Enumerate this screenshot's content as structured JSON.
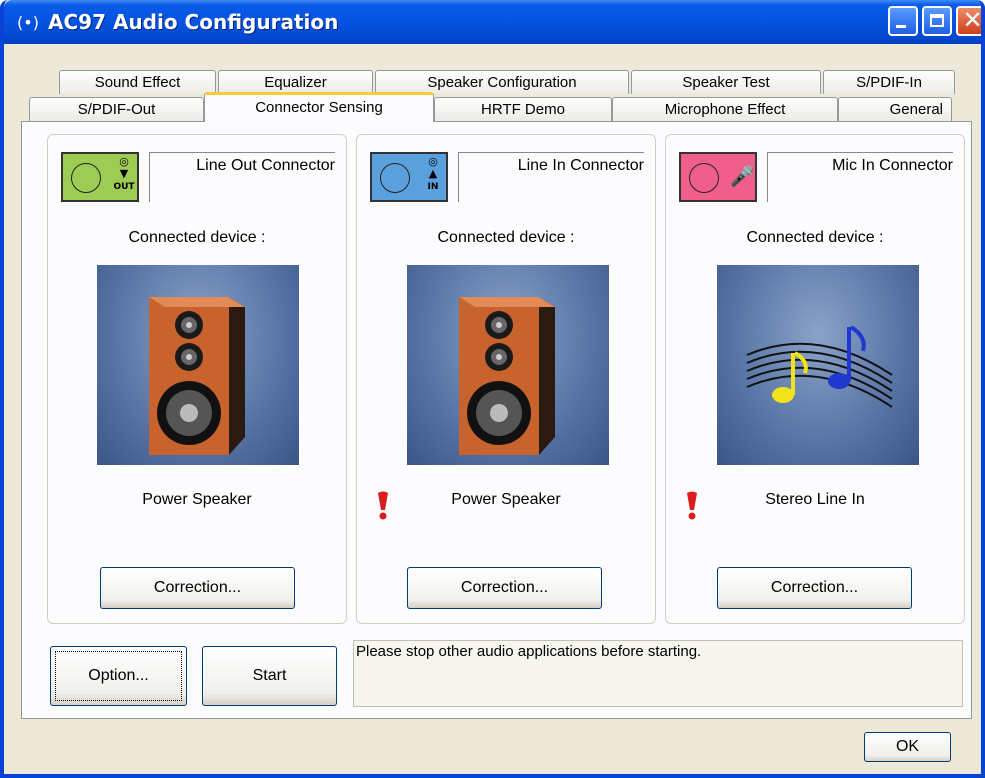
{
  "window": {
    "title": "AC97 Audio Configuration"
  },
  "tabs": {
    "row1": [
      "Sound Effect",
      "Equalizer",
      "Speaker Configuration",
      "Speaker Test",
      "S/PDIF-In"
    ],
    "row2": [
      "S/PDIF-Out",
      "Connector Sensing",
      "HRTF Demo",
      "Microphone Effect",
      "General"
    ],
    "active": "Connector Sensing"
  },
  "connectors": [
    {
      "name": "Line Out Connector",
      "jack_color": "#9ccc53",
      "jack_symbol": "OUT",
      "icon": "speaker-out-icon",
      "connected_label": "Connected device :",
      "device": "Power Speaker",
      "warning": false,
      "button": "Correction..."
    },
    {
      "name": "Line In Connector",
      "jack_color": "#5aa0dc",
      "jack_symbol": "IN",
      "icon": "speaker-in-icon",
      "connected_label": "Connected device :",
      "device": "Power Speaker",
      "warning": true,
      "button": "Correction..."
    },
    {
      "name": "Mic In Connector",
      "jack_color": "#f05f8c",
      "jack_symbol": "",
      "icon": "microphone-icon",
      "connected_label": "Connected device :",
      "device": "Stereo Line In",
      "warning": true,
      "button": "Correction..."
    }
  ],
  "bottom": {
    "option_button": "Option...",
    "start_button": "Start",
    "status": "Please stop other audio applications before starting."
  },
  "ok_button": "OK",
  "colors": {
    "title_bar": "#0553e0",
    "active_tab_accent": "#ffc83c",
    "warning": "#d81e1e"
  }
}
